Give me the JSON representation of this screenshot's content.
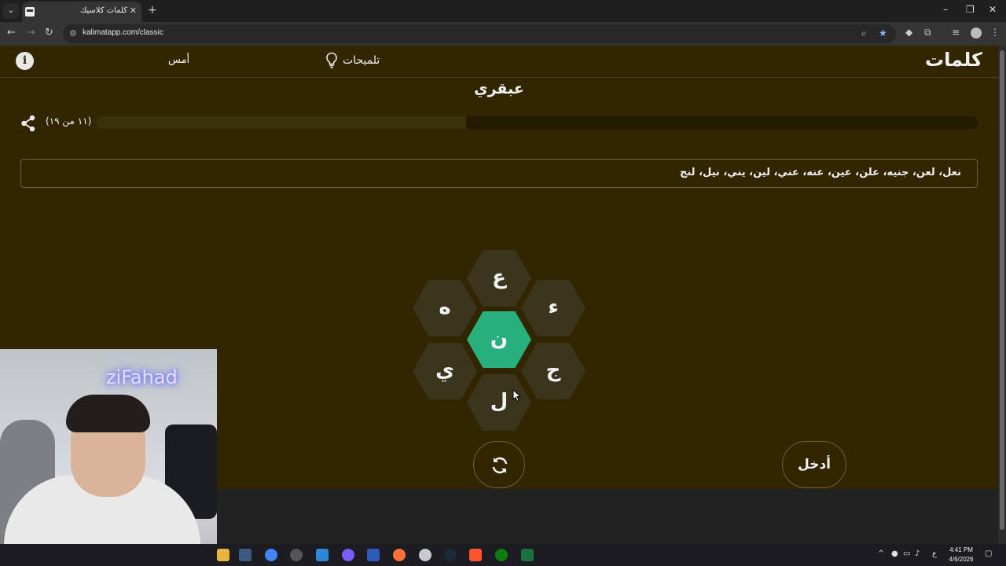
{
  "browser": {
    "tab_title": "كلمات كلاسيك",
    "url": "kalimatapp.com/classic"
  },
  "app": {
    "logo": "كلمات",
    "hints_label": "تلميحات",
    "yesterday_label": "أمس",
    "rank": "عبقري",
    "progress_text": "(١١ من ١٩)",
    "progress_fraction": 0.58,
    "found_words": "نعل، لعن، جنيه، علن، عين، عنه، عني، لين، يني، نيل، لنج",
    "enter_label": "أدخل"
  },
  "letters": {
    "center": "ن",
    "top": "ع",
    "top_right": "ء",
    "bottom_right": "ج",
    "bottom": "ل",
    "bottom_left": "ي",
    "top_left": "ه"
  },
  "webcam": {
    "neon_text": "ziFahad"
  },
  "taskbar": {
    "time": "4:41 PM",
    "date": "4/6/2026",
    "lang": "ع"
  },
  "colors": {
    "page_bg": "#322600",
    "center_hex": "#27b07e",
    "outer_hex": "#3c351e"
  }
}
